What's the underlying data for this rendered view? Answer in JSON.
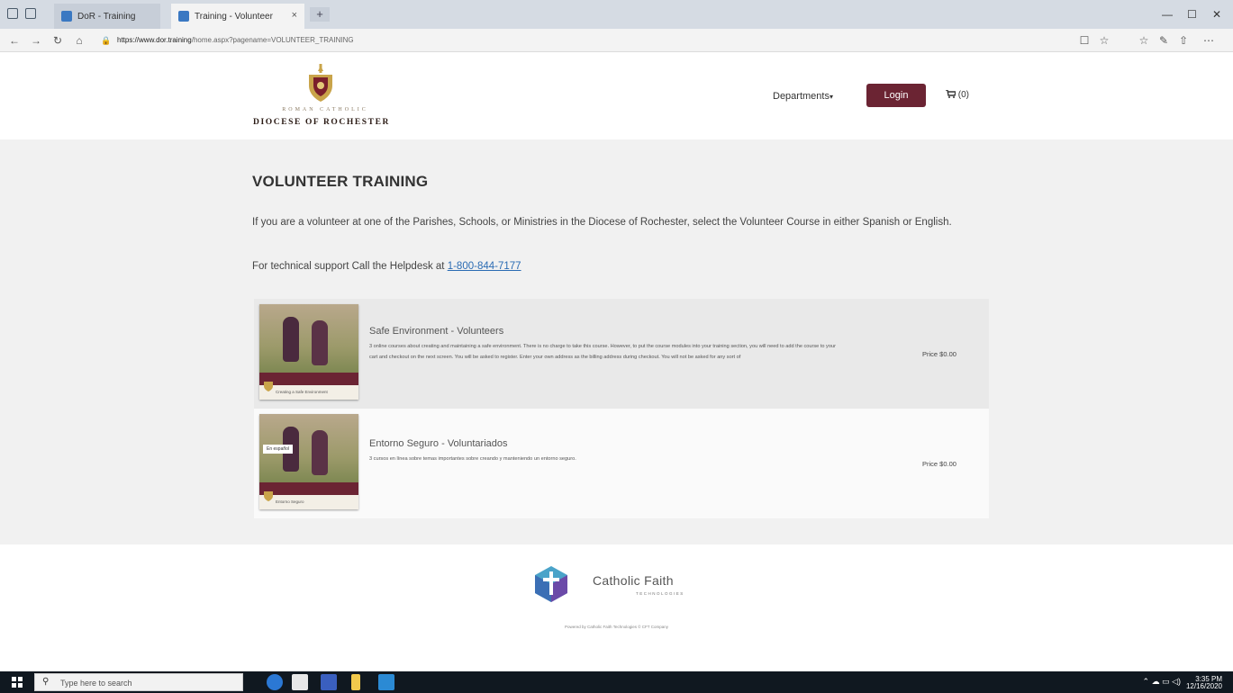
{
  "browser": {
    "tabs": [
      {
        "label": "DoR - Training"
      },
      {
        "label": "Training - Volunteer"
      }
    ],
    "new_tab": "+",
    "tab_close": "×",
    "url_domain": "https://www.dor.training",
    "url_path": "/home.aspx?pagename=VOLUNTEER_TRAINING",
    "nav": {
      "back": "←",
      "forward": "→",
      "refresh": "↻",
      "home": "⌂",
      "lock": "🔒"
    },
    "window": {
      "minimize": "—",
      "maximize": "☐",
      "close": "✕"
    },
    "toolbar": {
      "reading": "☐",
      "favorite": "☆",
      "favorites": "☆",
      "notes": "✎",
      "share": "⇧",
      "more": "⋯"
    }
  },
  "header": {
    "logo_small": "ROMAN CATHOLIC",
    "logo_big": "DIOCESE OF ROCHESTER",
    "departments": "Departments",
    "departments_caret": "▾",
    "login": "Login",
    "cart_count": "(0)"
  },
  "main": {
    "title": "VOLUNTEER TRAINING",
    "intro": "If you are a volunteer at one of the Parishes, Schools, or Ministries in the Diocese of Rochester, select the Volunteer Course in either Spanish or English.",
    "support_prefix": "For technical support Call the Helpdesk at ",
    "support_phone": "1-800-844-7177",
    "courses": [
      {
        "name": "Safe Environment - Volunteers",
        "description": "3 online courses about creating and maintaining a safe environment. There is no charge to take this course. However, to put the course modules into your training section, you will need to add the course to your cart and checkout on the next screen. You will be asked to register. Enter your own address as the billing address during checkout. You will not be asked for any sort of",
        "price": "Price $0.00",
        "thumb_caption": "Creating a Safe Environment",
        "badge": ""
      },
      {
        "name": "Entorno Seguro - Voluntariados",
        "description": "3 cursos en línea sobre temas importantes sobre creando y manteniendo un entorno seguro.",
        "price": "Price $0.00",
        "thumb_caption": "Entorno Seguro",
        "badge": "En español"
      }
    ]
  },
  "footer": {
    "brand": "Catholic Faith",
    "brand_sub": "TECHNOLOGIES",
    "copyright": "Powered by Catholic Faith Technologies © CFT Company"
  },
  "taskbar": {
    "search_placeholder": "Type here to search",
    "time": "3:35 PM",
    "date": "12/16/2020"
  },
  "colors": {
    "login_bg": "#6b2433",
    "main_bg": "#f1f1f1",
    "link": "#2a6bb3"
  }
}
